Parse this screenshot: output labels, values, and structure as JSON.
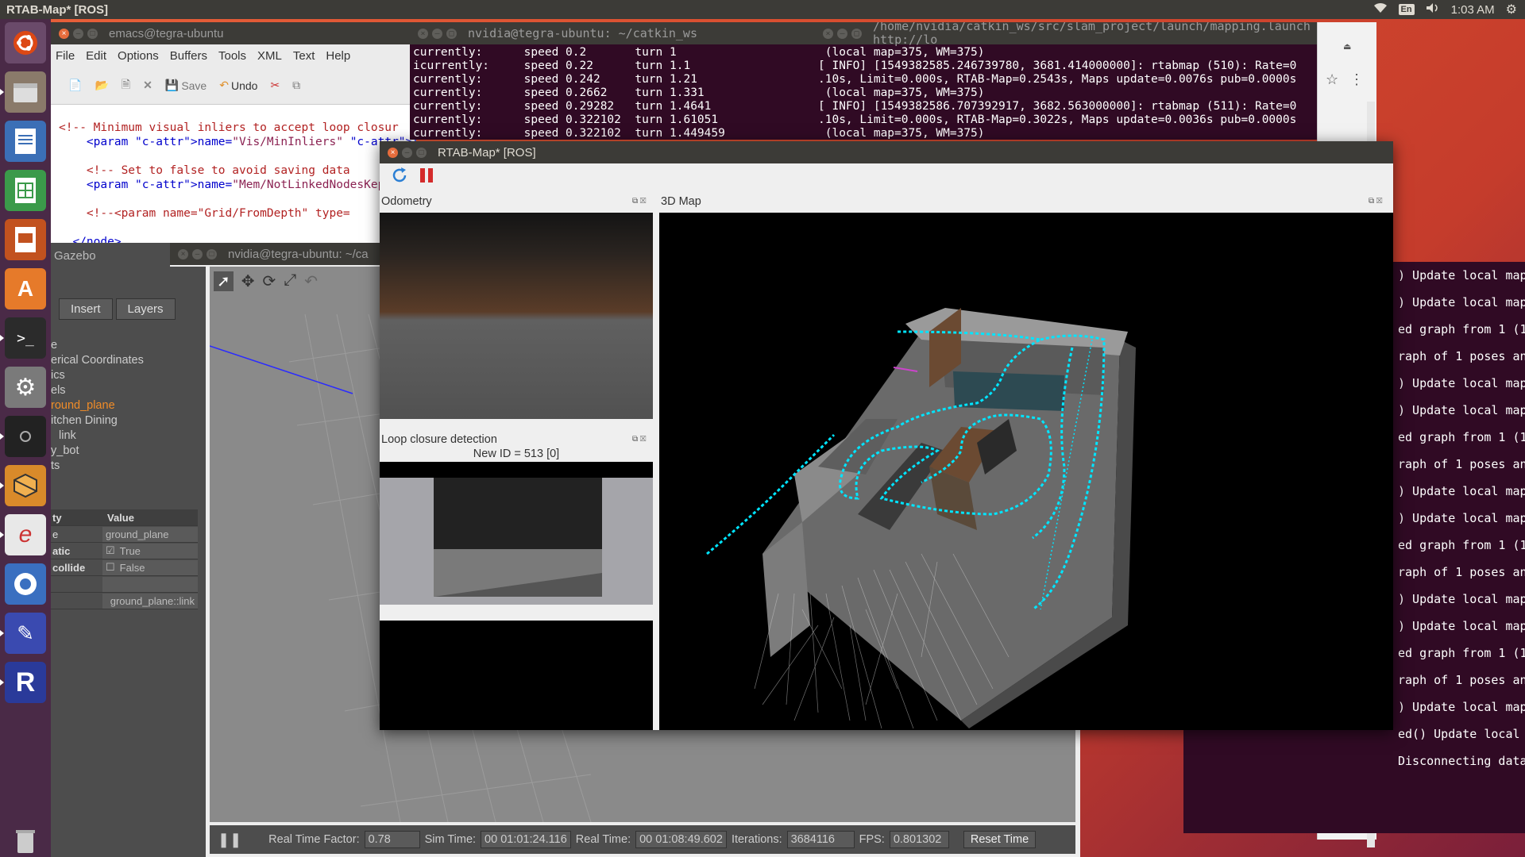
{
  "top_panel": {
    "active_window_title": "RTAB-Map* [ROS]",
    "keyboard_layout": "En",
    "clock": "1:03 AM"
  },
  "launcher": {
    "items": [
      "ubuntu-dash",
      "files",
      "writer",
      "calc",
      "impress",
      "software-center",
      "terminal",
      "system-settings",
      "camera-app",
      "box-app",
      "emacs",
      "chromium",
      "other-app",
      "rtabmap",
      "trash"
    ]
  },
  "emacs": {
    "title": "emacs@tegra-ubuntu",
    "menu": [
      "File",
      "Edit",
      "Options",
      "Buffers",
      "Tools",
      "XML",
      "Text",
      "Help"
    ],
    "toolbar": {
      "save_label": "Save",
      "undo_label": "Undo"
    },
    "code_lines": [
      "<!-- Minimum visual inliers to accept loop closur",
      "    <param name=\"Vis/MinInliers\" type=\"string\" ",
      "",
      "    <!-- Set to false to avoid saving data ",
      "    <param name=\"Mem/NotLinkedNodesKept\" ty",
      "",
      "    <!--<param name=\"Grid/FromDepth\" type=",
      "",
      "  </node>"
    ]
  },
  "terminal_catkin": {
    "title": "nvidia@tegra-ubuntu: ~/catkin_ws",
    "lines": [
      "currently:      speed 0.2       turn 1",
      "icurrently:     speed 0.22      turn 1.1",
      "currently:      speed 0.242     turn 1.21",
      "currently:      speed 0.2662    turn 1.331",
      "currently:      speed 0.29282   turn 1.4641",
      "currently:      speed 0.322102  turn 1.61051",
      "currently:      speed 0.322102  turn 1.449459"
    ]
  },
  "terminal_launch": {
    "title": "/home/nvidia/catkin_ws/src/slam_project/launch/mapping.launch http://lo",
    "lines": [
      " (local map=375, WM=375)",
      "[ INFO] [1549382585.246739780, 3681.414000000]: rtabmap (510): Rate=0",
      ".10s, Limit=0.000s, RTAB-Map=0.2543s, Maps update=0.0076s pub=0.0000s",
      " (local map=375, WM=375)",
      "[ INFO] [1549382586.707392917, 3682.563000000]: rtabmap (511): Rate=0",
      ".10s, Limit=0.000s, RTAB-Map=0.3022s, Maps update=0.0036s pub=0.0000s",
      " (local map=375, WM=375)"
    ]
  },
  "terminal_log": {
    "lines": [
      ") Update local map",
      ") Update local map",
      "ed graph from 1 (1",
      "raph of 1 poses an",
      ") Update local map",
      ") Update local map",
      "ed graph from 1 (1",
      "raph of 1 poses an",
      ") Update local map",
      ") Update local map",
      "ed graph from 1 (1",
      "raph of 1 poses an",
      ") Update local map",
      ") Update local map",
      "ed graph from 1 (1",
      "raph of 1 poses an",
      ") Update local map",
      "ed() Update local map",
      "Disconnecting databas"
    ]
  },
  "gazebo": {
    "window_title": "nvidia@tegra-ubuntu: ~/ca",
    "app_title": "Gazebo",
    "tabs": [
      "Insert",
      "Layers"
    ],
    "tree": [
      "e",
      "erical Coordinates",
      "ics",
      "els",
      "round_plane",
      "itchen Dining",
      "link",
      "y_bot",
      "ts"
    ],
    "props_header": {
      "key": "ty",
      "value": "Value"
    },
    "props": [
      {
        "key": "e",
        "value": "ground_plane"
      },
      {
        "key": "atic",
        "value": "True"
      },
      {
        "key": "collide",
        "value": "False"
      },
      {
        "key": "",
        "value": ""
      },
      {
        "key": "",
        "value": "ground_plane::link"
      }
    ],
    "status": {
      "rtf_label": "Real Time Factor:",
      "rtf": "0.78",
      "sim_label": "Sim Time:",
      "sim": "00 01:01:24.116",
      "real_label": "Real Time:",
      "real": "00 01:08:49.602",
      "iter_label": "Iterations:",
      "iter": "3684116",
      "fps_label": "FPS:",
      "fps": "0.801302",
      "reset_label": "Reset Time"
    }
  },
  "rtab": {
    "title": "RTAB-Map* [ROS]",
    "odometry_title": "Odometry",
    "map_title": "3D Map",
    "loop_title": "Loop closure detection",
    "new_id": "New ID = 513 [0]"
  },
  "colors": {
    "terminal_bg": "#300a24",
    "launcher_bg": "#4a2a47",
    "map_trajectory": "#00e5ff"
  }
}
